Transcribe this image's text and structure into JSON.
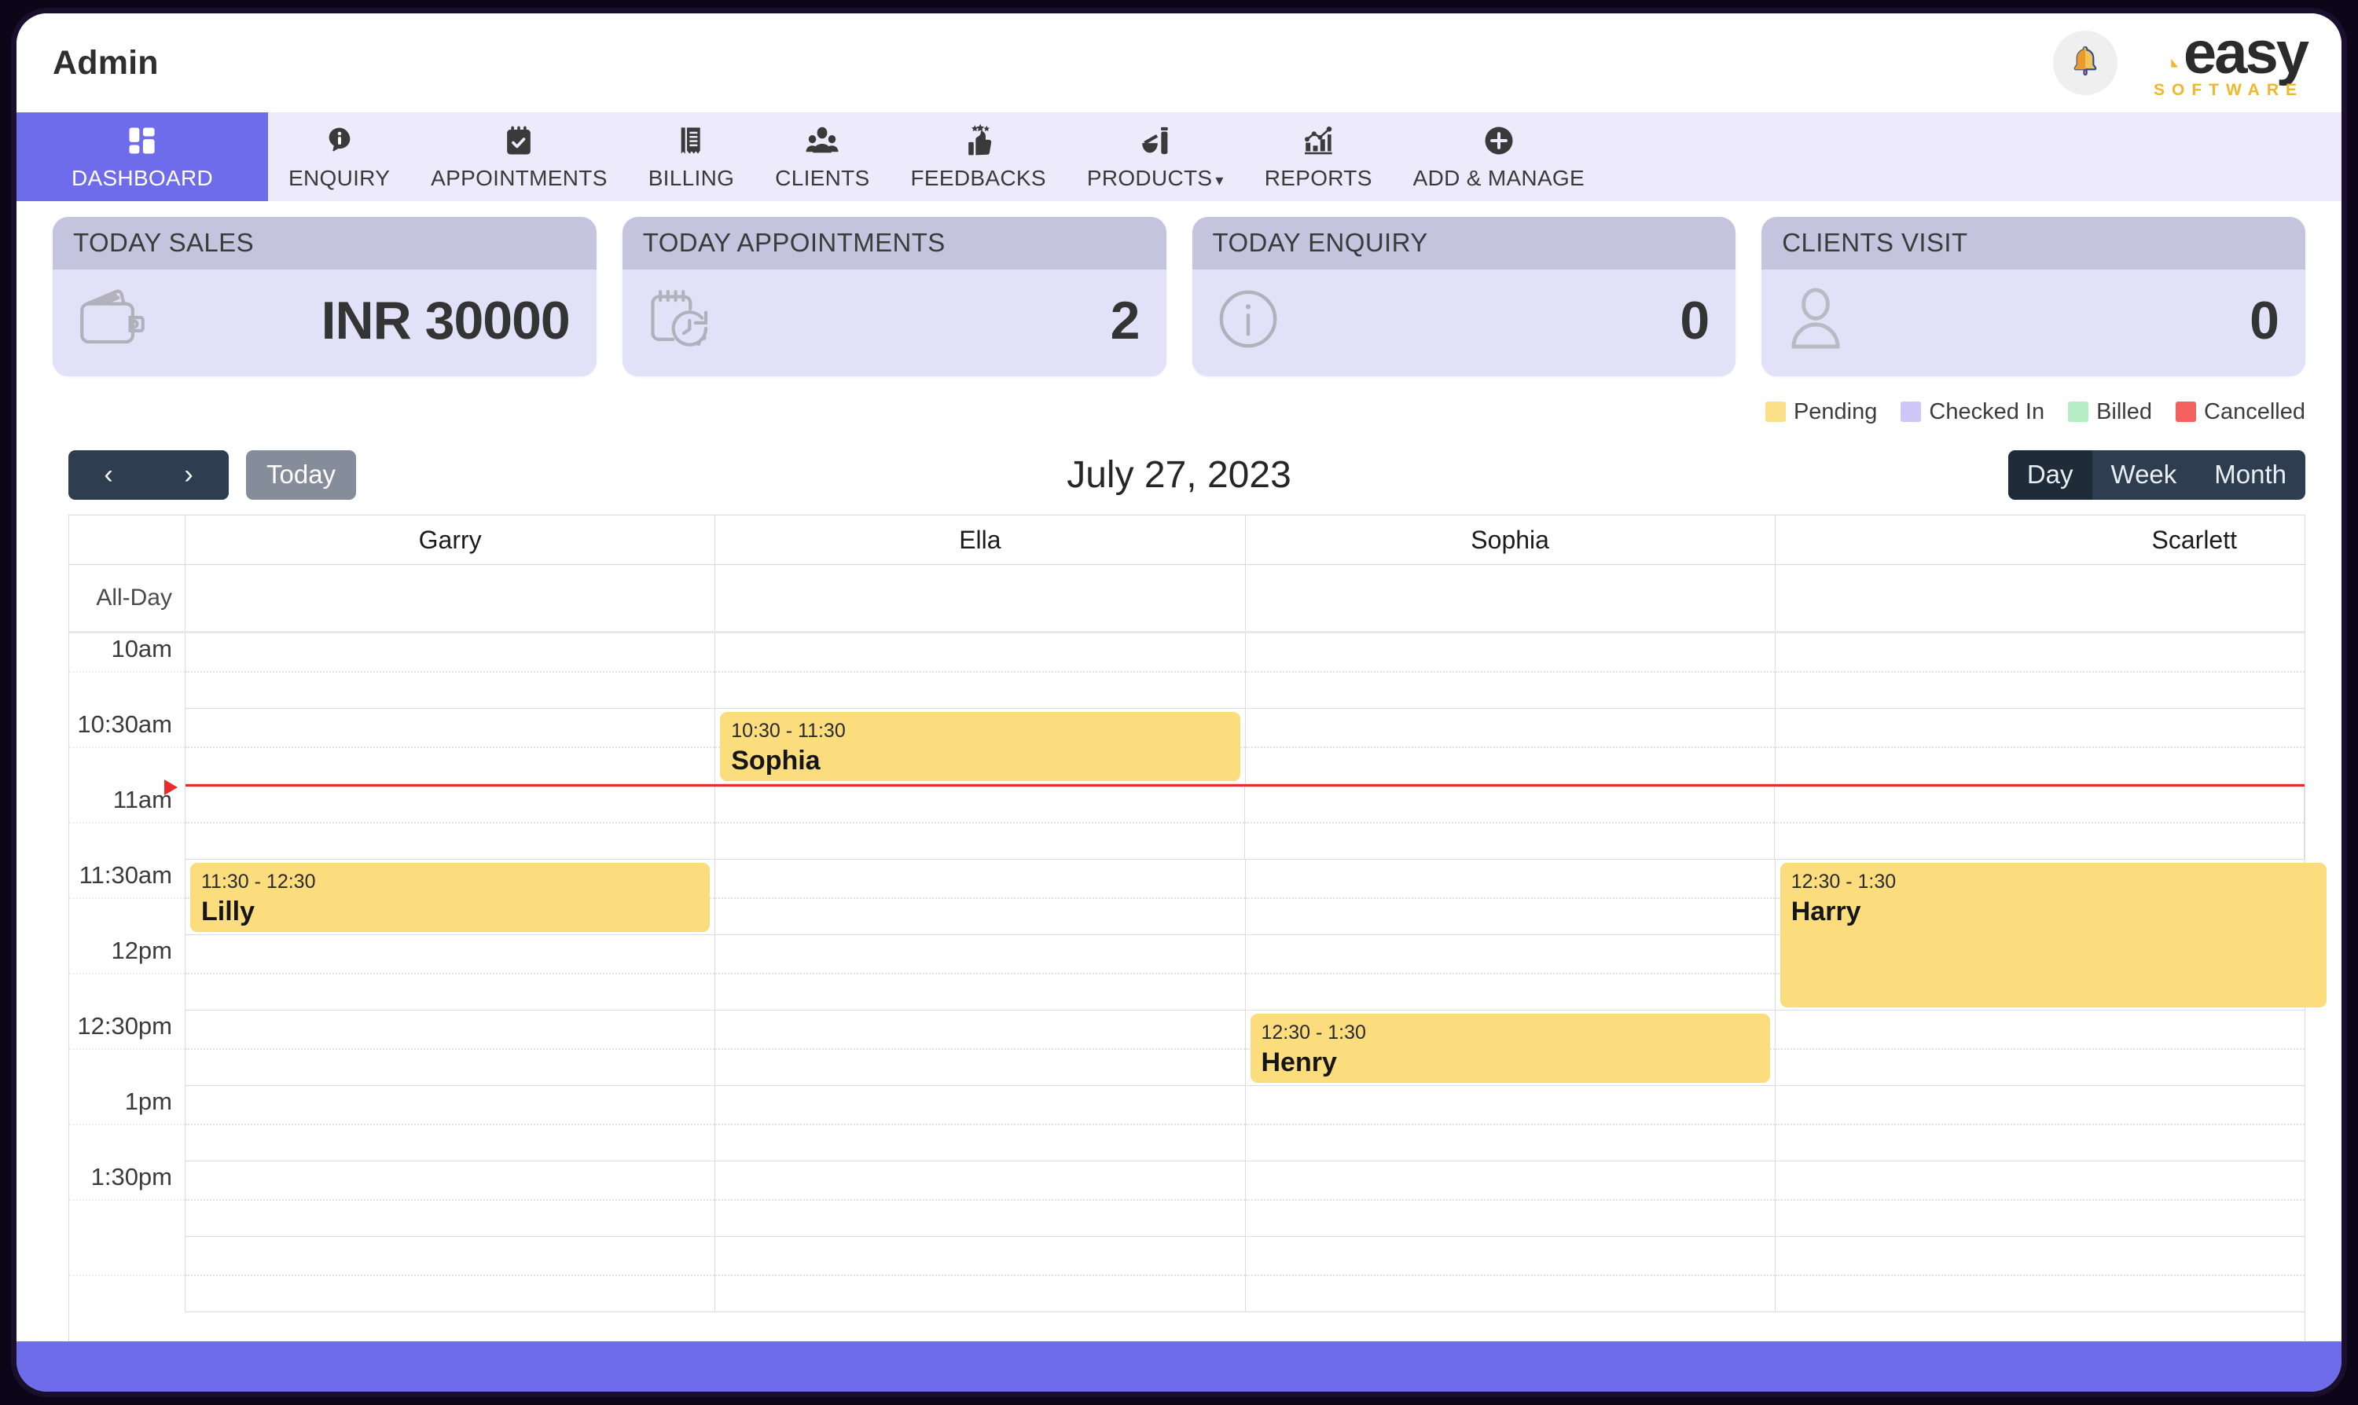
{
  "header": {
    "app_title": "Admin",
    "bell_icon": "notification-bell-icon",
    "logo_word": "easy",
    "logo_sub": "SOFTWARE"
  },
  "nav": {
    "items": [
      {
        "label": "DASHBOARD",
        "icon": "dashboard-grid-icon",
        "active": true,
        "caret": ""
      },
      {
        "label": "ENQUIRY",
        "icon": "info-speech-icon",
        "active": false,
        "caret": ""
      },
      {
        "label": "APPOINTMENTS",
        "icon": "calendar-check-icon",
        "active": false,
        "caret": ""
      },
      {
        "label": "BILLING",
        "icon": "receipt-icon",
        "active": false,
        "caret": ""
      },
      {
        "label": "CLIENTS",
        "icon": "people-group-icon",
        "active": false,
        "caret": ""
      },
      {
        "label": "FEEDBACKS",
        "icon": "thumbs-up-stars-icon",
        "active": false,
        "caret": ""
      },
      {
        "label": "PRODUCTS",
        "icon": "products-bottle-icon",
        "active": false,
        "caret": "▾"
      },
      {
        "label": "REPORTS",
        "icon": "bar-chart-icon",
        "active": false,
        "caret": ""
      },
      {
        "label": "ADD & MANAGE",
        "icon": "plus-circle-icon",
        "active": false,
        "caret": ""
      }
    ]
  },
  "kpis": [
    {
      "title": "TODAY SALES",
      "value": "INR 30000",
      "icon": "wallet-icon"
    },
    {
      "title": "TODAY APPOINTMENTS",
      "value": "2",
      "icon": "calendar-clock-icon"
    },
    {
      "title": "TODAY ENQUIRY",
      "value": "0",
      "icon": "info-circle-icon"
    },
    {
      "title": "CLIENTS VISIT",
      "value": "0",
      "icon": "person-icon"
    }
  ],
  "legend": [
    {
      "label": "Pending",
      "color": "#fbe08a"
    },
    {
      "label": "Checked In",
      "color": "#cdc6f7"
    },
    {
      "label": "Billed",
      "color": "#b6ecc4"
    },
    {
      "label": "Cancelled",
      "color": "#f4625f"
    }
  ],
  "toolbar": {
    "prev_icon": "chevron-left-icon",
    "prev_label": "‹",
    "next_icon": "chevron-right-icon",
    "next_label": "›",
    "today_label": "Today",
    "date_title": "July 27, 2023",
    "views": [
      {
        "label": "Day",
        "active": true
      },
      {
        "label": "Week",
        "active": false
      },
      {
        "label": "Month",
        "active": false
      }
    ]
  },
  "calendar": {
    "allday_label": "All-Day",
    "columns": [
      "Garry",
      "Ella",
      "Sophia",
      "Scarlett"
    ],
    "time_slots": [
      "10am",
      "10:30am",
      "11am",
      "11:30am",
      "12pm",
      "12:30pm",
      "1pm",
      "1:30pm"
    ],
    "now_indicator_slot": "11am",
    "events": [
      {
        "column": "Ella",
        "time": "10:30 - 11:30",
        "name": "Sophia",
        "status": "Pending",
        "color": "#fbdd7e",
        "start_slot": "10:30am",
        "duration_slots": 1
      },
      {
        "column": "Garry",
        "time": "11:30 - 12:30",
        "name": "Lilly",
        "status": "Pending",
        "color": "#fbdd7e",
        "start_slot": "11:30am",
        "duration_slots": 1
      },
      {
        "column": "Scarlett",
        "time": "12:30 - 1:30",
        "name": "Harry",
        "status": "Pending",
        "color": "#fbdd7e",
        "start_slot": "11:30am",
        "duration_slots": 2
      },
      {
        "column": "Sophia",
        "time": "12:30 - 1:30",
        "name": "Henry",
        "status": "Pending",
        "color": "#fbdd7e",
        "start_slot": "12:30pm",
        "duration_slots": 1
      }
    ]
  },
  "footer": {
    "color": "#6f6ceb"
  }
}
